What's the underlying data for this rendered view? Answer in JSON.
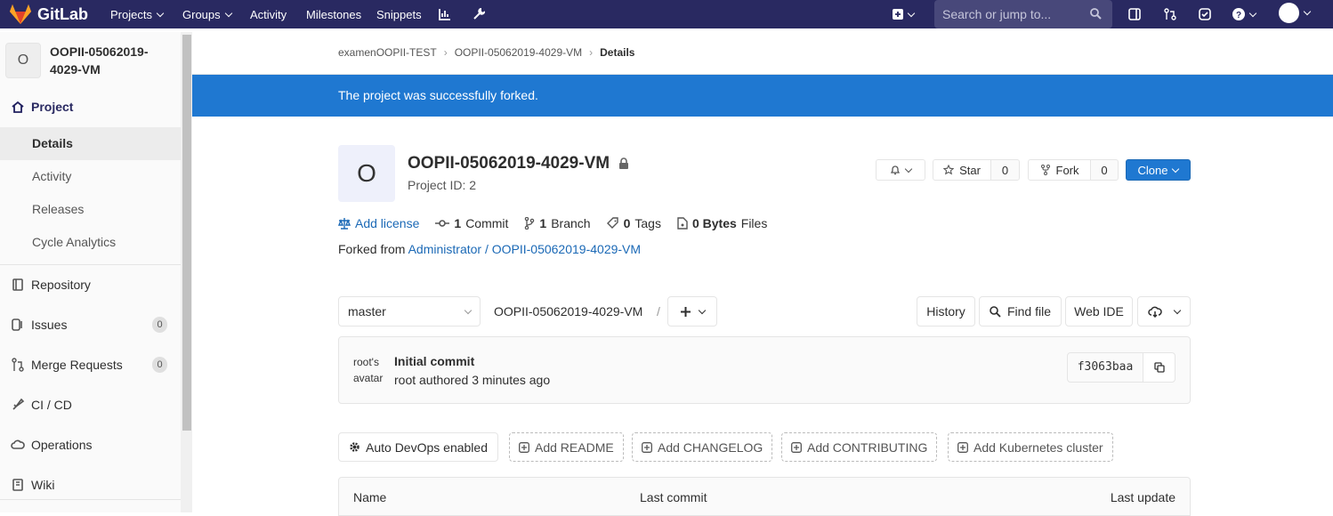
{
  "topbar": {
    "brand": "GitLab",
    "nav": [
      {
        "label": "Projects",
        "dropdown": true
      },
      {
        "label": "Groups",
        "dropdown": true
      },
      {
        "label": "Activity"
      },
      {
        "label": "Milestones"
      },
      {
        "label": "Snippets"
      }
    ],
    "search_placeholder": "Search or jump to...",
    "bg_color": "#292961"
  },
  "sidebar": {
    "context_letter": "O",
    "context_name": "OOPII-05062019-4029-VM",
    "project_label": "Project",
    "project_sub": [
      "Details",
      "Activity",
      "Releases",
      "Cycle Analytics"
    ],
    "items": [
      {
        "label": "Repository",
        "icon": "book-icon"
      },
      {
        "label": "Issues",
        "icon": "issues-icon",
        "count": "0"
      },
      {
        "label": "Merge Requests",
        "icon": "merge-request-icon",
        "count": "0"
      },
      {
        "label": "CI / CD",
        "icon": "rocket-icon"
      },
      {
        "label": "Operations",
        "icon": "cloud-gear-icon"
      },
      {
        "label": "Wiki",
        "icon": "book-open-icon"
      }
    ]
  },
  "breadcrumb": [
    "examenOOPII-TEST",
    "OOPII-05062019-4029-VM",
    "Details"
  ],
  "flash": "The project was successfully forked.",
  "project": {
    "avatar_letter": "O",
    "title": "OOPII-05062019-4029-VM",
    "project_id": "Project ID: 2",
    "star_label": "Star",
    "star_count": "0",
    "fork_label": "Fork",
    "fork_count": "0",
    "clone_label": "Clone",
    "add_license": "Add license",
    "stats": [
      {
        "n": "1",
        "label": "Commit"
      },
      {
        "n": "1",
        "label": "Branch"
      },
      {
        "n": "0",
        "label": "Tags"
      },
      {
        "n": "0 Bytes",
        "label": "Files"
      }
    ],
    "forked_from_label": "Forked from",
    "forked_from_link": "Administrator / OOPII-05062019-4029-VM"
  },
  "repo": {
    "branch": "master",
    "path": "OOPII-05062019-4029-VM",
    "path_sep": "/",
    "history": "History",
    "find_file": "Find file",
    "web_ide": "Web IDE"
  },
  "commit": {
    "avatar_alt": "root's avatar",
    "title": "Initial commit",
    "author": "root",
    "authored": "authored",
    "time": "3 minutes ago",
    "sha": "f3063baa"
  },
  "actions": {
    "autodevops": "Auto DevOps enabled",
    "readme": "Add README",
    "changelog": "Add CHANGELOG",
    "contributing": "Add CONTRIBUTING",
    "k8s": "Add Kubernetes cluster"
  },
  "table": {
    "name": "Name",
    "last_commit": "Last commit",
    "last_update": "Last update"
  }
}
